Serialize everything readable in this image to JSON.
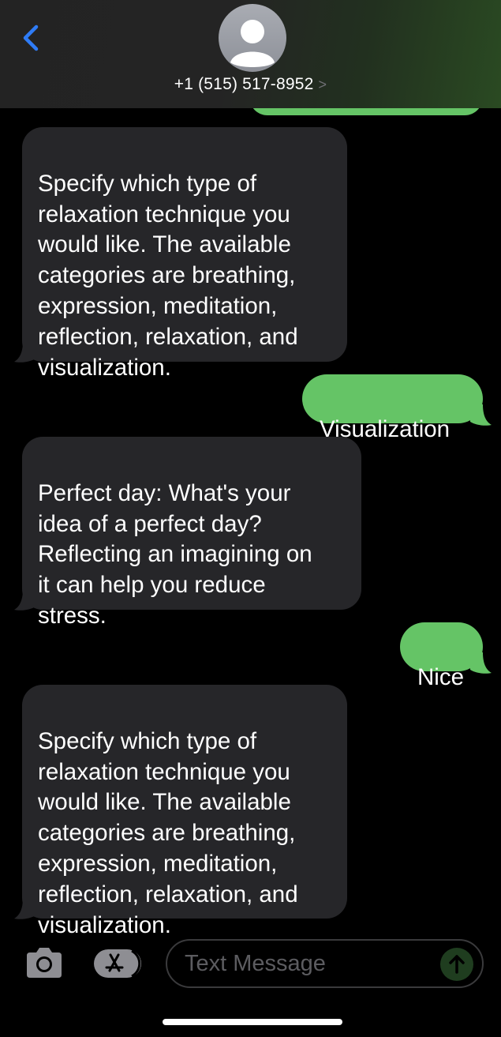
{
  "header": {
    "contact": "+1 (515) 517-8952",
    "chevron": ">"
  },
  "messages": [
    {
      "direction": "incoming",
      "text": "Specify which type of\nrelaxation technique you\nwould like. The available\ncategories are breathing,\nexpression, meditation,\nreflection, relaxation, and\nvisualization."
    },
    {
      "direction": "outgoing",
      "text": "Visualization"
    },
    {
      "direction": "incoming",
      "text": "Perfect day: What's your\nidea of a perfect day?\nReflecting an imagining on\nit can help you reduce\nstress."
    },
    {
      "direction": "outgoing",
      "text": "Nice"
    },
    {
      "direction": "incoming",
      "text": "Specify which type of\nrelaxation technique you\nwould like. The available\ncategories are breathing,\nexpression, meditation,\nreflection, relaxation, and\nvisualization."
    }
  ],
  "composer": {
    "placeholder": "Text Message"
  },
  "colors": {
    "outgoing_bubble": "#65c466",
    "incoming_bubble": "#262629",
    "accent": "#2f7cf6"
  }
}
